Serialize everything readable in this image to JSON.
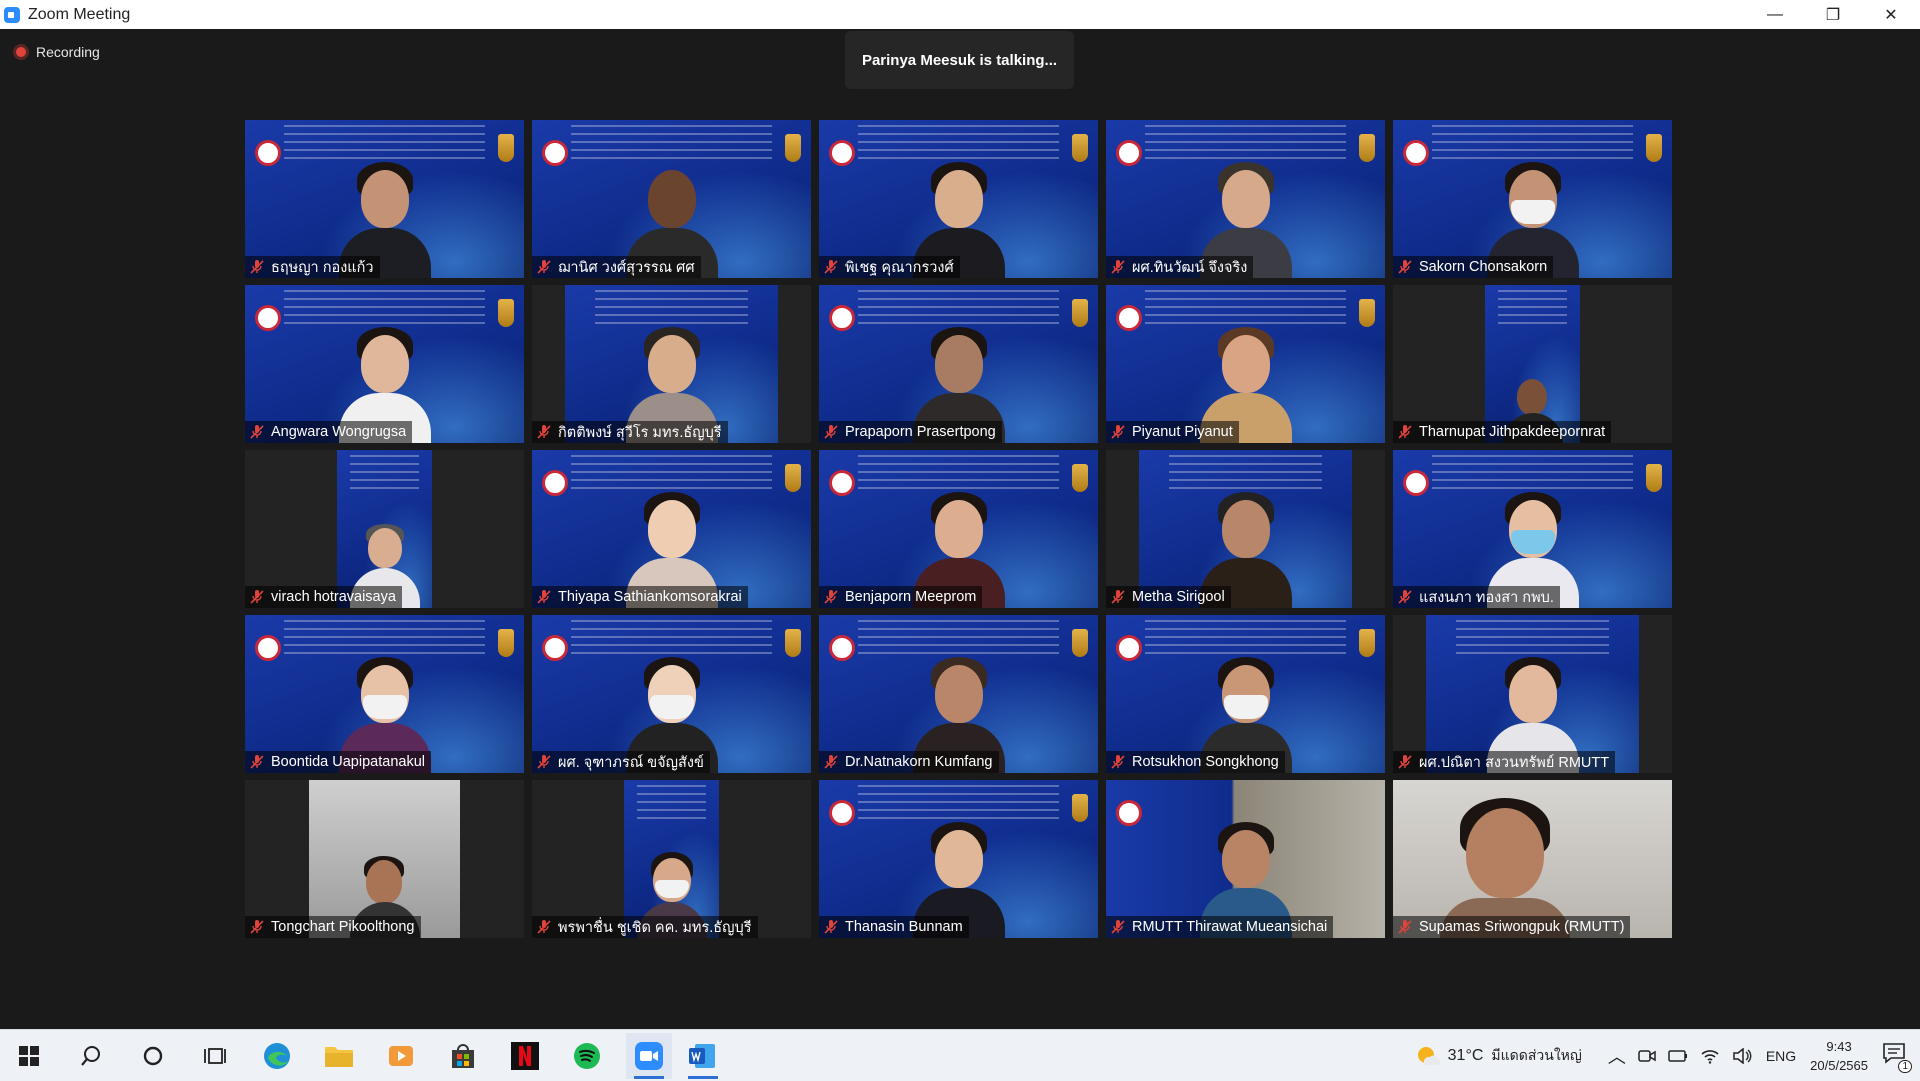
{
  "window": {
    "title": "Zoom Meeting",
    "controls": {
      "minimize": "—",
      "restore": "❐",
      "close": "✕"
    }
  },
  "meeting": {
    "recording_label": "Recording",
    "talking_banner": "Parinya Meesuk is talking..."
  },
  "participants": [
    {
      "name": "ธฤษญา กองแก้ว"
    },
    {
      "name": "ฌานิศ วงศ์สุวรรณ ศศ"
    },
    {
      "name": "พิเชฐ คุณากรวงศ์"
    },
    {
      "name": "ผศ.ทินวัฒน์ จึงจริง"
    },
    {
      "name": "Sakorn Chonsakorn"
    },
    {
      "name": "Angwara Wongrugsa"
    },
    {
      "name": "กิตติพงษ์ สุวีโร มทร.ธัญบุรี"
    },
    {
      "name": "Prapaporn Prasertpong"
    },
    {
      "name": "Piyanut Piyanut"
    },
    {
      "name": "Tharnupat Jithpakdeepornrat"
    },
    {
      "name": "virach hotravaisaya"
    },
    {
      "name": "Thiyapa Sathiankomsorakrai"
    },
    {
      "name": "Benjaporn Meeprom"
    },
    {
      "name": "Metha Sirigool"
    },
    {
      "name": "แสงนภา ทองสา กพบ."
    },
    {
      "name": "Boontida Uapipatanakul"
    },
    {
      "name": "ผศ. จุฑาภรณ์ ขจัญสังข์"
    },
    {
      "name": "Dr.Natnakorn Kumfang"
    },
    {
      "name": "Rotsukhon Songkhong"
    },
    {
      "name": "ผศ.ปณิตา สงวนทรัพย์ RMUTT"
    },
    {
      "name": "Tongchart Pikoolthong"
    },
    {
      "name": "พรพาชื่น ชูเชิด คค. มทร.ธัญบุรี"
    },
    {
      "name": "Thanasin Bunnam"
    },
    {
      "name": "RMUTT Thirawat Mueansichai"
    },
    {
      "name": "Supamas Sriwongpuk (RMUTT)"
    }
  ],
  "taskbar": {
    "apps": [
      "start",
      "search",
      "cortana",
      "task-view",
      "edge",
      "file-explorer",
      "media-player",
      "store",
      "netflix",
      "spotify",
      "zoom",
      "word"
    ],
    "weather_temp": "31°C",
    "weather_desc": "มีแดดส่วนใหญ่",
    "language": "ENG",
    "time": "9:43",
    "date": "20/5/2565",
    "notification_count": "1"
  },
  "colors": {
    "stage_bg": "#1a1a1a",
    "mute_red": "#e0433a",
    "zoom_blue": "#2d8cff",
    "taskbar_bg": "#eef1f6"
  }
}
